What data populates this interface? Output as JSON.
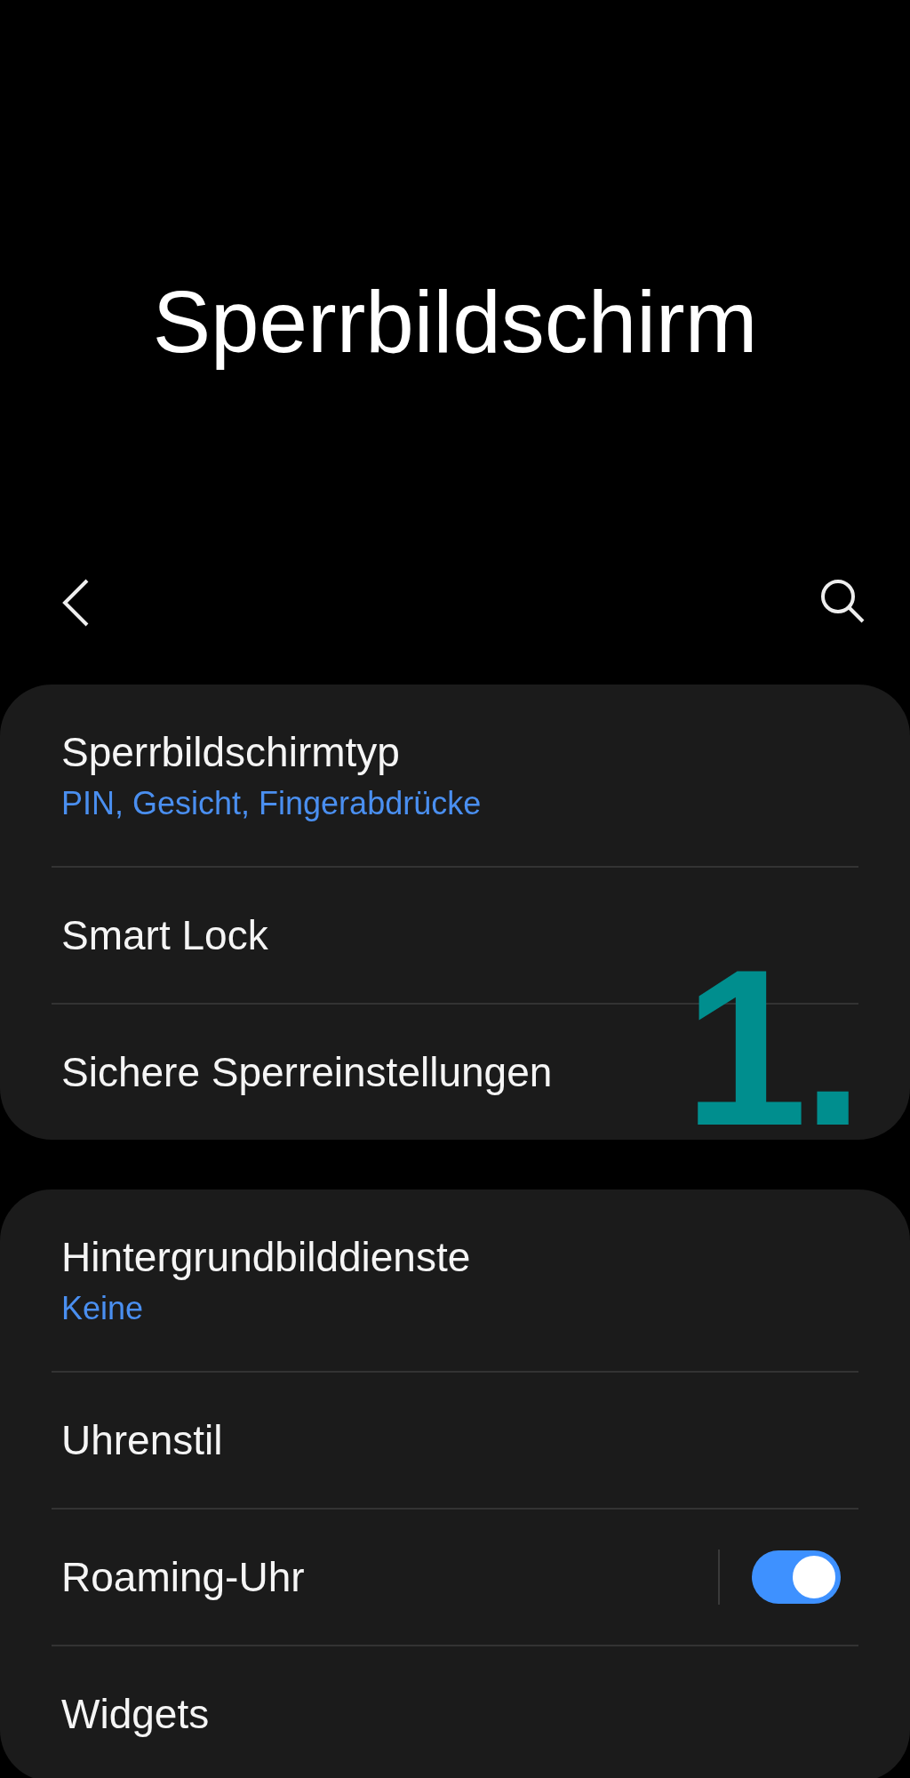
{
  "title": "Sperrbildschirm",
  "groups": [
    {
      "annotation": "1.",
      "items": [
        {
          "kind": "plain",
          "title": "Sperrbildschirmtyp",
          "subtitle": "PIN, Gesicht, Fingerabdrücke"
        },
        {
          "kind": "plain",
          "title": "Smart Lock"
        },
        {
          "kind": "plain",
          "title": "Sichere Sperreinstellungen"
        }
      ]
    },
    {
      "items": [
        {
          "kind": "plain",
          "title": "Hintergrundbilddienste",
          "subtitle": "Keine"
        },
        {
          "kind": "plain",
          "title": "Uhrenstil"
        },
        {
          "kind": "switch",
          "title": "Roaming-Uhr",
          "on": true
        },
        {
          "kind": "plain",
          "title": "Widgets"
        }
      ]
    }
  ]
}
